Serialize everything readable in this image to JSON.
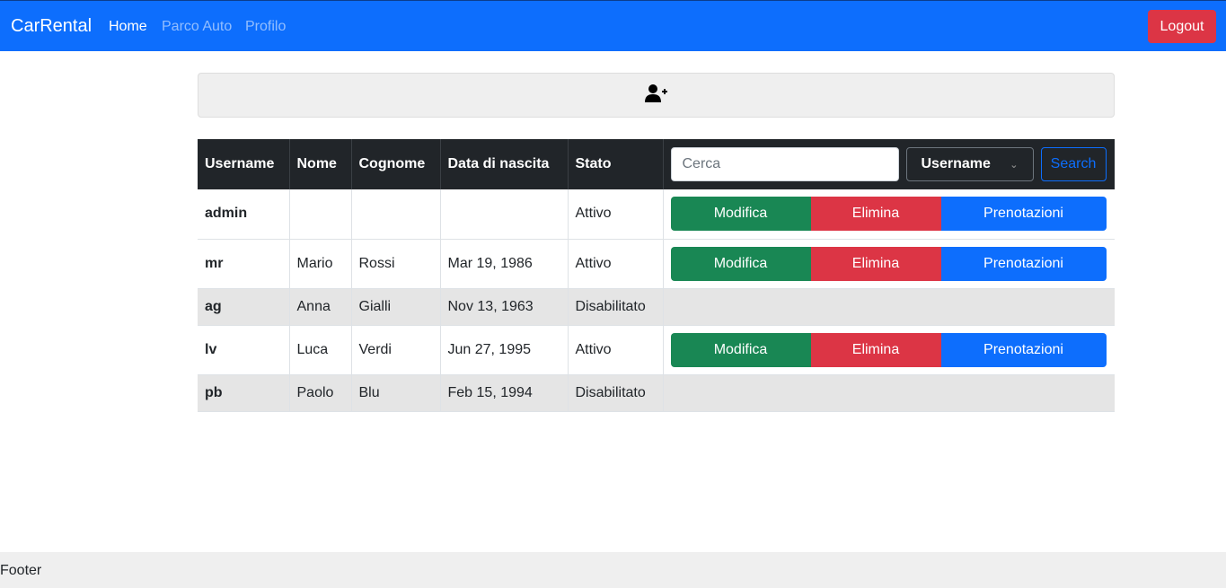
{
  "navbar": {
    "brand": "CarRental",
    "links": [
      "Home",
      "Parco Auto",
      "Profilo"
    ],
    "logout": "Logout"
  },
  "toolbar": {
    "add_user_icon": "user-plus-icon"
  },
  "table": {
    "headers": [
      "Username",
      "Nome",
      "Cognome",
      "Data di nascita",
      "Stato"
    ],
    "search_placeholder": "Cerca",
    "filter_selected": "Username",
    "search_button": "Search",
    "actions": {
      "edit": "Modifica",
      "delete": "Elimina",
      "bookings": "Prenotazioni"
    },
    "rows": [
      {
        "username": "admin",
        "nome": "",
        "cognome": "",
        "nascita": "",
        "stato": "Attivo"
      },
      {
        "username": "mr",
        "nome": "Mario",
        "cognome": "Rossi",
        "nascita": "Mar 19, 1986",
        "stato": "Attivo"
      },
      {
        "username": "ag",
        "nome": "Anna",
        "cognome": "Gialli",
        "nascita": "Nov 13, 1963",
        "stato": "Disabilitato"
      },
      {
        "username": "lv",
        "nome": "Luca",
        "cognome": "Verdi",
        "nascita": "Jun 27, 1995",
        "stato": "Attivo"
      },
      {
        "username": "pb",
        "nome": "Paolo",
        "cognome": "Blu",
        "nascita": "Feb 15, 1994",
        "stato": "Disabilitato"
      }
    ]
  },
  "footer": {
    "text": "Footer"
  },
  "colors": {
    "primary": "#0d6efd",
    "danger": "#dc3545",
    "success": "#198754",
    "dark": "#212529"
  }
}
